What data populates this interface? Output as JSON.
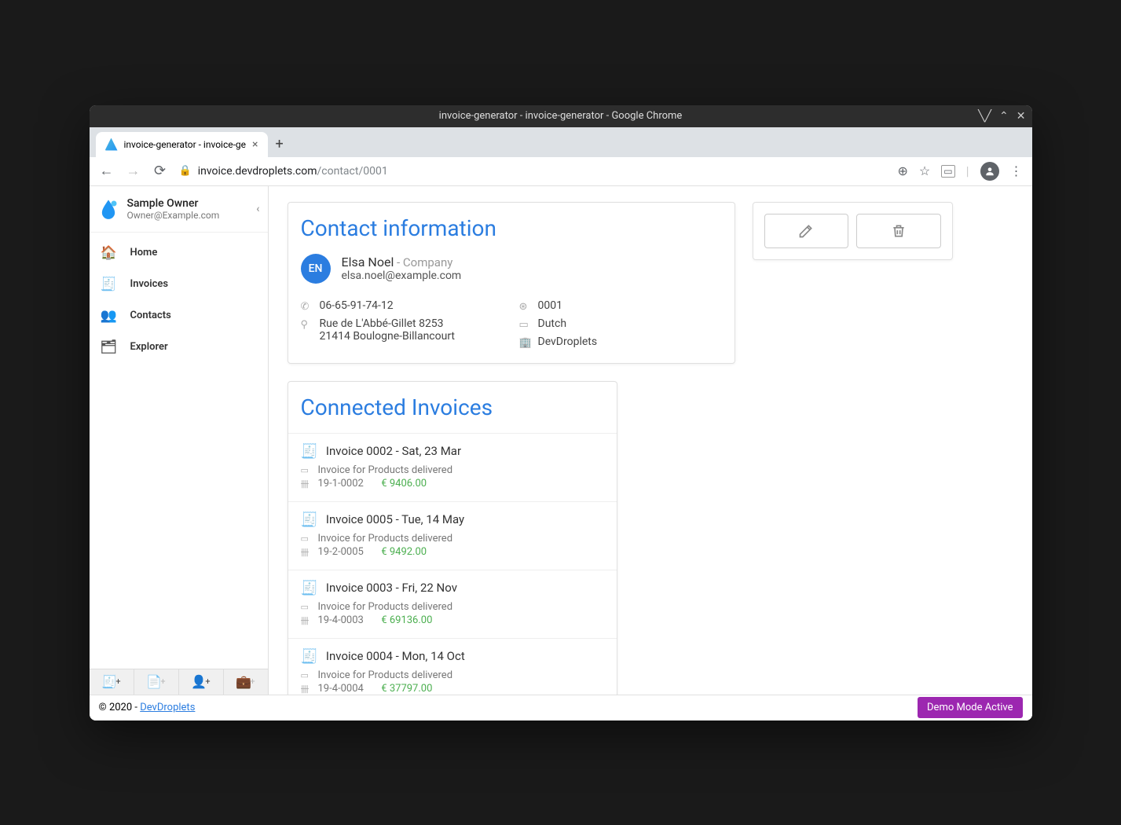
{
  "window": {
    "title": "invoice-generator - invoice-generator - Google Chrome"
  },
  "browser": {
    "tab_title": "invoice-generator - invoice-ge",
    "url_domain": "invoice.devdroplets.com",
    "url_path": "/contact/0001"
  },
  "owner": {
    "name": "Sample Owner",
    "email": "Owner@Example.com"
  },
  "nav": {
    "home": "Home",
    "invoices": "Invoices",
    "contacts": "Contacts",
    "explorer": "Explorer"
  },
  "contact_card": {
    "heading": "Contact information",
    "initials": "EN",
    "name": "Elsa Noel",
    "company_label": " - Company",
    "email": "elsa.noel@example.com",
    "phone": "06-65-91-74-12",
    "address_line1": "Rue de L'Abbé-Gillet 8253",
    "address_line2": "21414 Boulogne-Billancourt",
    "id": "0001",
    "language": "Dutch",
    "org": "DevDroplets"
  },
  "invoices": {
    "heading": "Connected Invoices",
    "items": [
      {
        "title": "Invoice 0002 - Sat, 23 Mar",
        "desc": "Invoice for Products delivered",
        "ref": "19-1-0002",
        "amount": "€ 9406.00"
      },
      {
        "title": "Invoice 0005 - Tue, 14 May",
        "desc": "Invoice for Products delivered",
        "ref": "19-2-0005",
        "amount": "€ 9492.00"
      },
      {
        "title": "Invoice 0003 - Fri, 22 Nov",
        "desc": "Invoice for Products delivered",
        "ref": "19-4-0003",
        "amount": "€ 69136.00"
      },
      {
        "title": "Invoice 0004 - Mon, 14 Oct",
        "desc": "Invoice for Products delivered",
        "ref": "19-4-0004",
        "amount": "€ 37797.00"
      }
    ]
  },
  "footer": {
    "copyright": "© 2020 - ",
    "link": "DevDroplets",
    "demo": "Demo Mode Active"
  }
}
